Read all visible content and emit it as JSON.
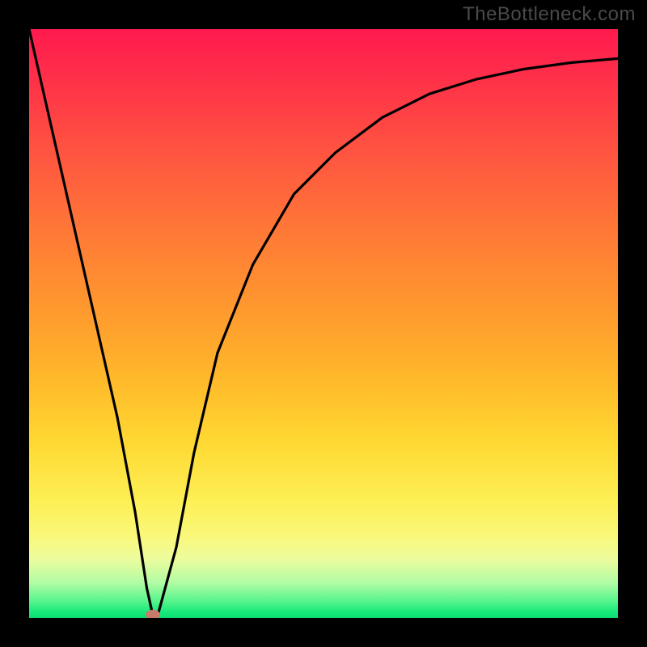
{
  "watermark": "TheBottleneck.com",
  "colors": {
    "frame_bg": "#000000",
    "curve_stroke": "#000000",
    "marker_fill": "#c97a6a",
    "gradient_top": "#ff1a4f",
    "gradient_bottom": "#0adf72"
  },
  "chart_data": {
    "type": "line",
    "title": "",
    "xlabel": "",
    "ylabel": "",
    "xlim": [
      0,
      100
    ],
    "ylim": [
      0,
      100
    ],
    "series": [
      {
        "name": "bottleneck-curve",
        "x": [
          0,
          5,
          10,
          15,
          18,
          20,
          21,
          22,
          25,
          28,
          32,
          38,
          45,
          52,
          60,
          68,
          76,
          84,
          92,
          100
        ],
        "y": [
          100,
          78,
          56,
          34,
          18,
          5,
          0.5,
          1,
          12,
          28,
          45,
          60,
          72,
          79,
          85,
          89,
          91.5,
          93.2,
          94.3,
          95
        ]
      }
    ],
    "annotations": [
      {
        "name": "optimal-marker",
        "x": 21,
        "y": 0.5
      }
    ],
    "grid": false,
    "legend": false
  }
}
